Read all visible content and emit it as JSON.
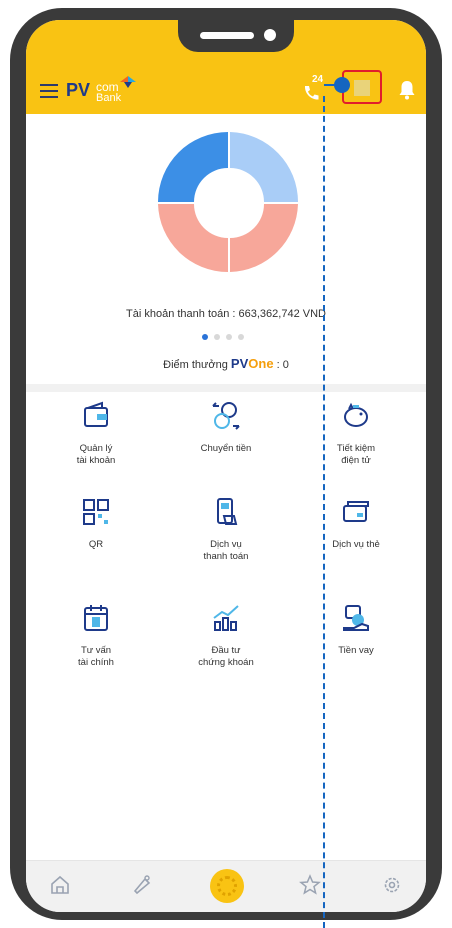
{
  "app": {
    "logo_pv": "PV",
    "logo_com": "com",
    "logo_bank": "Bank",
    "hotline_number": "24"
  },
  "balance": {
    "text": "Tài khoản thanh toán : 663,362,742 VND"
  },
  "points": {
    "label": "Điểm thưởng",
    "brand_pv": "PV",
    "brand_one": "One",
    "value": ": 0"
  },
  "services": [
    {
      "label": "Quản lý\ntài khoản",
      "icon": "wallet-icon"
    },
    {
      "label": "Chuyển tiền",
      "icon": "money-transfer-icon"
    },
    {
      "label": "Tiết kiệm\nđiện tử",
      "icon": "piggy-bank-icon"
    },
    {
      "label": "QR",
      "icon": "qr-code-icon"
    },
    {
      "label": "Dịch vụ\nthanh toán",
      "icon": "payment-service-icon"
    },
    {
      "label": "Dịch vụ thẻ",
      "icon": "card-icon"
    },
    {
      "label": "Tư vấn\ntài chính",
      "icon": "calendar-money-icon"
    },
    {
      "label": "Đầu tư\nchứng khoán",
      "icon": "investment-chart-icon"
    },
    {
      "label": "Tiền vay",
      "icon": "loan-icon"
    }
  ],
  "bottom_nav": [
    "home-icon",
    "promotion-icon",
    "center-action-icon",
    "favorite-icon",
    "settings-icon"
  ],
  "colors": {
    "brand_yellow": "#f9c313",
    "brand_navy": "#1e3a8a",
    "donut_blue": "#3c8fe6",
    "donut_light_blue": "#a9cdf7",
    "donut_salmon": "#f7a79a",
    "highlight_red": "#e11d2c",
    "guide_blue": "#1565c0"
  }
}
